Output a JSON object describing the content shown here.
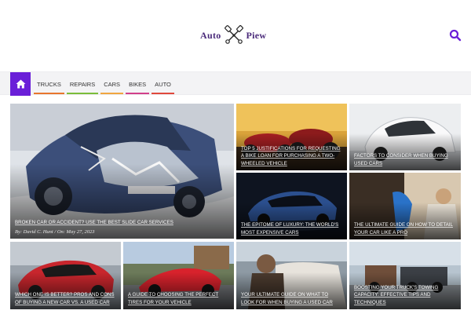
{
  "header": {
    "logo_left": "Auto",
    "logo_right": "Piew",
    "logo_icon": "crossed-pistons-icon",
    "search_icon": "search-icon"
  },
  "nav": {
    "home_icon": "home-icon",
    "items": [
      {
        "label": "TRUCKS",
        "color": "#e8762d"
      },
      {
        "label": "REPAIRS",
        "color": "#7bbd3a"
      },
      {
        "label": "CARS",
        "color": "#f0a640"
      },
      {
        "label": "BIKES",
        "color": "#d23f8a"
      },
      {
        "label": "AUTO",
        "color": "#e0483c"
      }
    ],
    "accent": "#6a1fd8"
  },
  "featured": {
    "title": "BROKEN CAR OR ACCIDENT? USE THE BEST SLIDE CAR SERVICES",
    "author": "By: David C. Hunt",
    "separator": "/",
    "date": "On: May 27, 2023"
  },
  "posts": [
    {
      "title": "TOP 5 JUSTIFICATIONS FOR REQUESTING A BIKE LOAN FOR PURCHASING A TWO-WHEELED VEHICLE"
    },
    {
      "title": "FACTORS TO CONSIDER WHEN BUYING USED CARS"
    },
    {
      "title": "THE EPITOME OF LUXURY: THE WORLD'S MOST EXPENSIVE CARS"
    },
    {
      "title": "THE ULTIMATE GUIDE ON HOW TO DETAIL YOUR CAR LIKE A PRO"
    },
    {
      "title": "WHICH ONE IS BETTER? PROS AND CONS OF BUYING A NEW CAR VS. A USED CAR"
    },
    {
      "title": "A GUIDE TO CHOOSING THE PERFECT TIRES FOR YOUR VEHICLE"
    },
    {
      "title": "YOUR ULTIMATE GUIDE ON WHAT TO LOOK FOR WHEN BUYING A USED CAR"
    },
    {
      "title": "BOOSTING YOUR TRUCK'S TOWING CAPACITY: EFFECTIVE TIPS AND TECHNIQUES"
    }
  ]
}
